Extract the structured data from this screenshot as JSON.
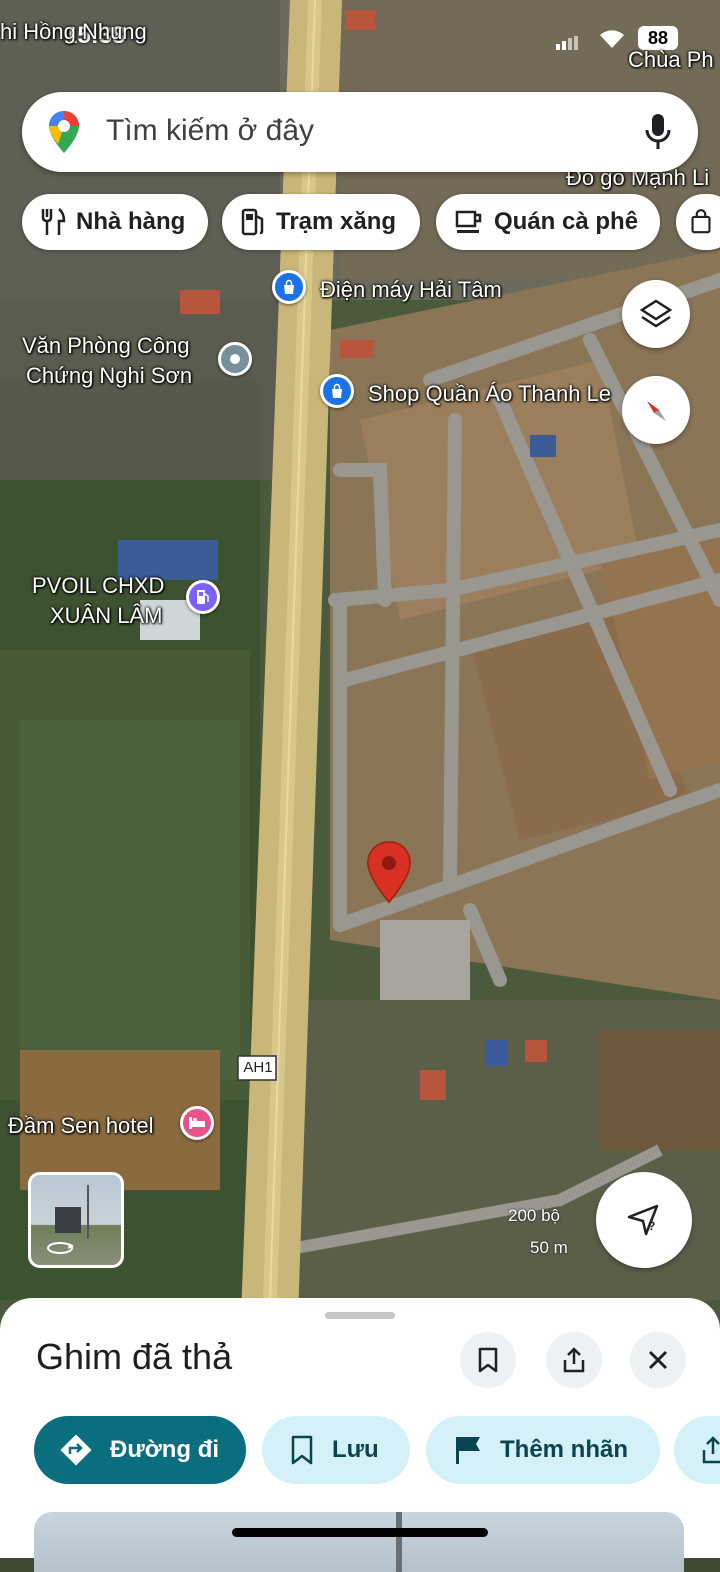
{
  "status_bar": {
    "time": "15:38",
    "battery": "88",
    "carrier_hint": "Chùa Ph"
  },
  "search": {
    "placeholder": "Tìm kiếm ở đây"
  },
  "chips": [
    {
      "label": "Nhà hàng",
      "icon": "fork-knife-icon"
    },
    {
      "label": "Trạm xăng",
      "icon": "gas-pump-icon"
    },
    {
      "label": "Quán cà phê",
      "icon": "coffee-cup-icon"
    }
  ],
  "map_labels": {
    "top_left": "hi Hồng Nhung",
    "top_right": "Đồ gỗ Mạnh Li",
    "dien_may": "Điện máy Hải Tâm",
    "van_phong_1": "Văn Phòng Công",
    "van_phong_2": "Chứng Nghi Sơn",
    "shop": "Shop Quần Áo Thanh Le",
    "pvoil_1": "PVOIL CHXD",
    "pvoil_2": "XUÂN LÂM",
    "road_shield": "AH1",
    "hotel": "Đầm Sen hotel",
    "scale_ft": "200 bộ",
    "scale_m": "50 m"
  },
  "sheet": {
    "title": "Ghim đã thả",
    "directions": "Đường đi",
    "save": "Lưu",
    "add_label": "Thêm nhãn"
  },
  "colors": {
    "accent_teal": "#0b6e7f",
    "pill_bg": "#d3f1f6",
    "pin_red": "#d93025"
  }
}
